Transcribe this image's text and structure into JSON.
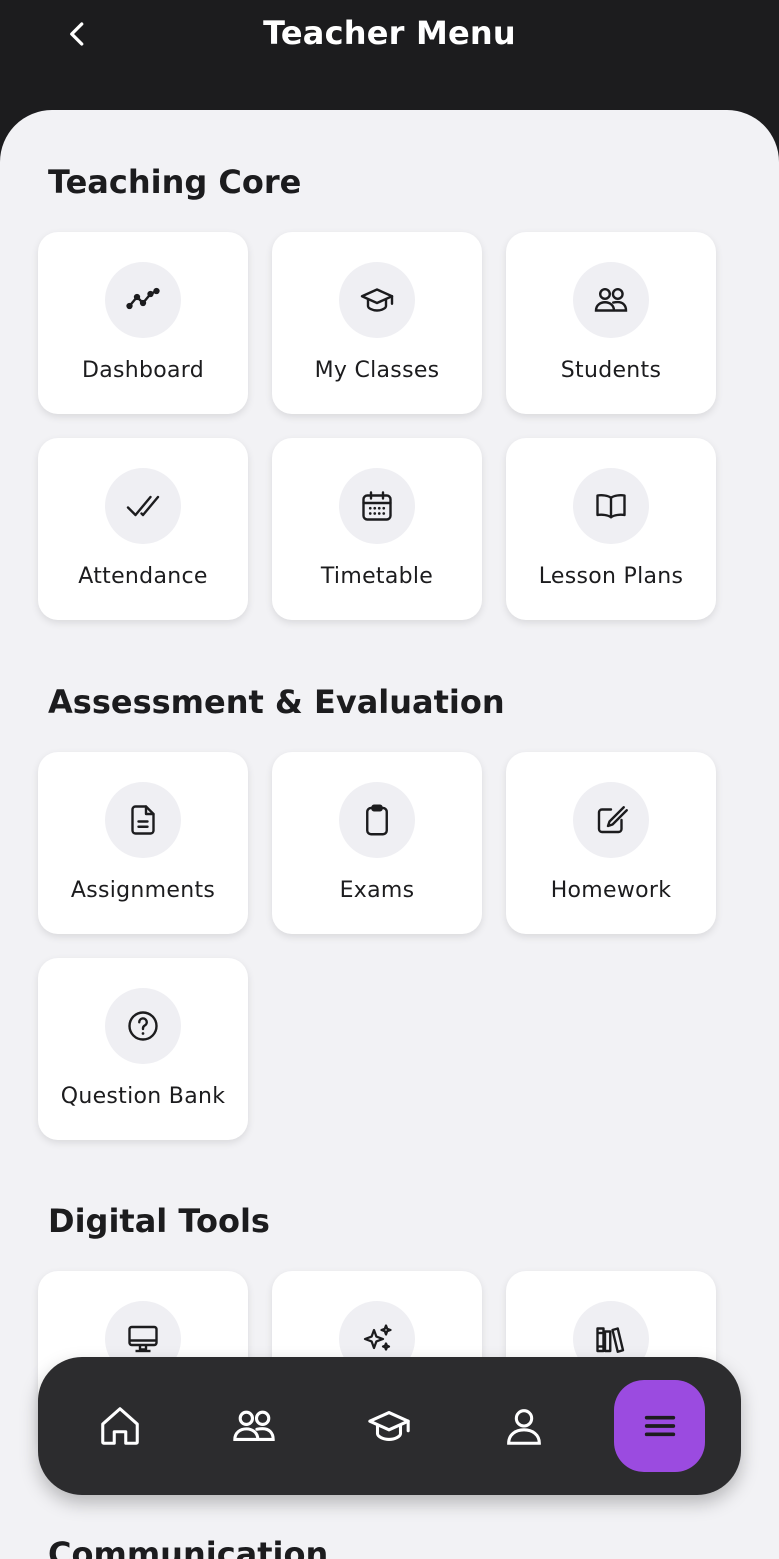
{
  "header": {
    "title": "Teacher Menu"
  },
  "sections": {
    "core": {
      "title": "Teaching Core",
      "items": [
        {
          "label": "Dashboard",
          "icon": "line-chart-icon"
        },
        {
          "label": "My Classes",
          "icon": "graduation-cap-icon"
        },
        {
          "label": "Students",
          "icon": "users-icon"
        },
        {
          "label": "Attendance",
          "icon": "double-check-icon"
        },
        {
          "label": "Timetable",
          "icon": "calendar-icon"
        },
        {
          "label": "Lesson Plans",
          "icon": "open-book-icon"
        }
      ]
    },
    "assessment": {
      "title": "Assessment & Evaluation",
      "items": [
        {
          "label": "Assignments",
          "icon": "document-icon"
        },
        {
          "label": "Exams",
          "icon": "clipboard-icon"
        },
        {
          "label": "Homework",
          "icon": "edit-square-icon"
        },
        {
          "label": "Question Bank",
          "icon": "question-circle-icon"
        }
      ]
    },
    "digital": {
      "title": "Digital Tools",
      "items": [
        {
          "icon": "monitor-icon"
        },
        {
          "icon": "sparkles-icon"
        },
        {
          "icon": "library-icon"
        }
      ]
    },
    "communication": {
      "title": "Communication"
    }
  },
  "bottom_nav": {
    "items": [
      "home-icon",
      "users-icon",
      "graduation-cap-icon",
      "person-icon",
      "menu-icon"
    ],
    "active": "menu-icon"
  },
  "colors": {
    "header_bg": "#1c1c1e",
    "sheet_bg": "#f2f2f5",
    "card_bg": "#ffffff",
    "icon_circle_bg": "#efeff3",
    "nav_bg": "#2c2c2e",
    "accent": "#9b4be0"
  }
}
